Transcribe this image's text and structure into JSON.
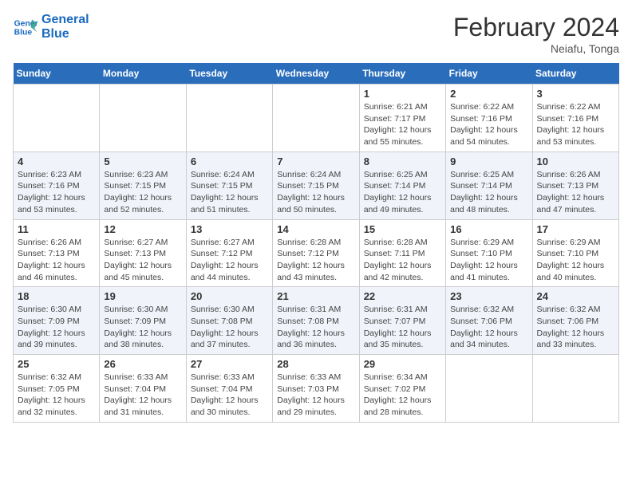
{
  "header": {
    "logo_line1": "General",
    "logo_line2": "Blue",
    "month": "February 2024",
    "location": "Neiafu, Tonga"
  },
  "weekdays": [
    "Sunday",
    "Monday",
    "Tuesday",
    "Wednesday",
    "Thursday",
    "Friday",
    "Saturday"
  ],
  "weeks": [
    [
      {
        "day": "",
        "info": ""
      },
      {
        "day": "",
        "info": ""
      },
      {
        "day": "",
        "info": ""
      },
      {
        "day": "",
        "info": ""
      },
      {
        "day": "1",
        "info": "Sunrise: 6:21 AM\nSunset: 7:17 PM\nDaylight: 12 hours\nand 55 minutes."
      },
      {
        "day": "2",
        "info": "Sunrise: 6:22 AM\nSunset: 7:16 PM\nDaylight: 12 hours\nand 54 minutes."
      },
      {
        "day": "3",
        "info": "Sunrise: 6:22 AM\nSunset: 7:16 PM\nDaylight: 12 hours\nand 53 minutes."
      }
    ],
    [
      {
        "day": "4",
        "info": "Sunrise: 6:23 AM\nSunset: 7:16 PM\nDaylight: 12 hours\nand 53 minutes."
      },
      {
        "day": "5",
        "info": "Sunrise: 6:23 AM\nSunset: 7:15 PM\nDaylight: 12 hours\nand 52 minutes."
      },
      {
        "day": "6",
        "info": "Sunrise: 6:24 AM\nSunset: 7:15 PM\nDaylight: 12 hours\nand 51 minutes."
      },
      {
        "day": "7",
        "info": "Sunrise: 6:24 AM\nSunset: 7:15 PM\nDaylight: 12 hours\nand 50 minutes."
      },
      {
        "day": "8",
        "info": "Sunrise: 6:25 AM\nSunset: 7:14 PM\nDaylight: 12 hours\nand 49 minutes."
      },
      {
        "day": "9",
        "info": "Sunrise: 6:25 AM\nSunset: 7:14 PM\nDaylight: 12 hours\nand 48 minutes."
      },
      {
        "day": "10",
        "info": "Sunrise: 6:26 AM\nSunset: 7:13 PM\nDaylight: 12 hours\nand 47 minutes."
      }
    ],
    [
      {
        "day": "11",
        "info": "Sunrise: 6:26 AM\nSunset: 7:13 PM\nDaylight: 12 hours\nand 46 minutes."
      },
      {
        "day": "12",
        "info": "Sunrise: 6:27 AM\nSunset: 7:13 PM\nDaylight: 12 hours\nand 45 minutes."
      },
      {
        "day": "13",
        "info": "Sunrise: 6:27 AM\nSunset: 7:12 PM\nDaylight: 12 hours\nand 44 minutes."
      },
      {
        "day": "14",
        "info": "Sunrise: 6:28 AM\nSunset: 7:12 PM\nDaylight: 12 hours\nand 43 minutes."
      },
      {
        "day": "15",
        "info": "Sunrise: 6:28 AM\nSunset: 7:11 PM\nDaylight: 12 hours\nand 42 minutes."
      },
      {
        "day": "16",
        "info": "Sunrise: 6:29 AM\nSunset: 7:10 PM\nDaylight: 12 hours\nand 41 minutes."
      },
      {
        "day": "17",
        "info": "Sunrise: 6:29 AM\nSunset: 7:10 PM\nDaylight: 12 hours\nand 40 minutes."
      }
    ],
    [
      {
        "day": "18",
        "info": "Sunrise: 6:30 AM\nSunset: 7:09 PM\nDaylight: 12 hours\nand 39 minutes."
      },
      {
        "day": "19",
        "info": "Sunrise: 6:30 AM\nSunset: 7:09 PM\nDaylight: 12 hours\nand 38 minutes."
      },
      {
        "day": "20",
        "info": "Sunrise: 6:30 AM\nSunset: 7:08 PM\nDaylight: 12 hours\nand 37 minutes."
      },
      {
        "day": "21",
        "info": "Sunrise: 6:31 AM\nSunset: 7:08 PM\nDaylight: 12 hours\nand 36 minutes."
      },
      {
        "day": "22",
        "info": "Sunrise: 6:31 AM\nSunset: 7:07 PM\nDaylight: 12 hours\nand 35 minutes."
      },
      {
        "day": "23",
        "info": "Sunrise: 6:32 AM\nSunset: 7:06 PM\nDaylight: 12 hours\nand 34 minutes."
      },
      {
        "day": "24",
        "info": "Sunrise: 6:32 AM\nSunset: 7:06 PM\nDaylight: 12 hours\nand 33 minutes."
      }
    ],
    [
      {
        "day": "25",
        "info": "Sunrise: 6:32 AM\nSunset: 7:05 PM\nDaylight: 12 hours\nand 32 minutes."
      },
      {
        "day": "26",
        "info": "Sunrise: 6:33 AM\nSunset: 7:04 PM\nDaylight: 12 hours\nand 31 minutes."
      },
      {
        "day": "27",
        "info": "Sunrise: 6:33 AM\nSunset: 7:04 PM\nDaylight: 12 hours\nand 30 minutes."
      },
      {
        "day": "28",
        "info": "Sunrise: 6:33 AM\nSunset: 7:03 PM\nDaylight: 12 hours\nand 29 minutes."
      },
      {
        "day": "29",
        "info": "Sunrise: 6:34 AM\nSunset: 7:02 PM\nDaylight: 12 hours\nand 28 minutes."
      },
      {
        "day": "",
        "info": ""
      },
      {
        "day": "",
        "info": ""
      }
    ]
  ]
}
